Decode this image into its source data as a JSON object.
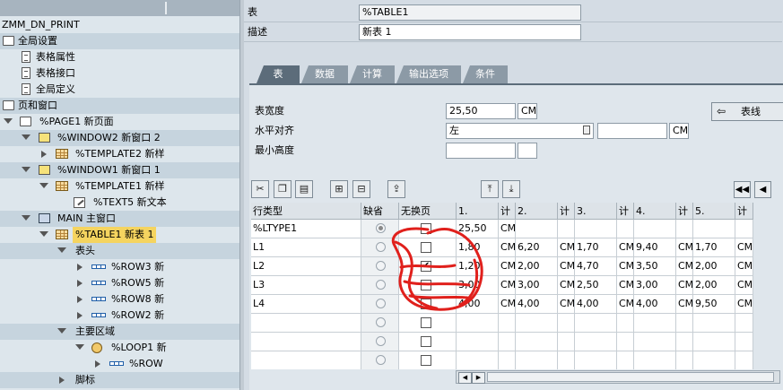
{
  "tree": {
    "rows": [
      {
        "label": "ZMM_DN_PRINT"
      },
      {
        "label": "全局设置"
      },
      {
        "label": "表格属性"
      },
      {
        "label": "表格接口"
      },
      {
        "label": "全局定义"
      },
      {
        "label": "页和窗口"
      },
      {
        "label": "%PAGE1 新页面"
      },
      {
        "label": "%WINDOW2 新窗口 2"
      },
      {
        "label": "%TEMPLATE2 新样"
      },
      {
        "label": "%WINDOW1 新窗口 1"
      },
      {
        "label": "%TEMPLATE1 新样"
      },
      {
        "label": "%TEXT5 新文本"
      },
      {
        "label": "MAIN 主窗口"
      },
      {
        "label": "%TABLE1 新表 1"
      },
      {
        "label": "表头"
      },
      {
        "label": "%ROW3 新"
      },
      {
        "label": "%ROW5 新"
      },
      {
        "label": "%ROW8 新"
      },
      {
        "label": "%ROW2 新"
      },
      {
        "label": "主要区域"
      },
      {
        "label": "%LOOP1 新"
      },
      {
        "label": "%ROW"
      },
      {
        "label": "脚标"
      }
    ]
  },
  "header": {
    "table_label": "表",
    "table_value": "%TABLE1",
    "desc_label": "描述",
    "desc_value": "新表 1"
  },
  "tabs": [
    {
      "label": "表"
    },
    {
      "label": "数据"
    },
    {
      "label": "计算"
    },
    {
      "label": "输出选项"
    },
    {
      "label": "条件"
    }
  ],
  "form": {
    "width_label": "表宽度",
    "width_value": "25,50",
    "width_unit": "CM",
    "align_label": "水平对齐",
    "align_value": "左",
    "align_unit": "CM",
    "minheight_label": "最小高度",
    "side_button": "表线"
  },
  "table": {
    "columns": [
      "行类型",
      "缺省",
      "无换页",
      "1.",
      "计",
      "2.",
      "计",
      "3.",
      "计",
      "4.",
      "计",
      "5.",
      "计"
    ],
    "rows": [
      {
        "type": "%LTYPE1",
        "default": true,
        "nobreak": false,
        "cells": [
          "25,50",
          "CM",
          "",
          "",
          "",
          "",
          "",
          "",
          "",
          ""
        ]
      },
      {
        "type": "L1",
        "default": false,
        "nobreak": false,
        "cells": [
          "1,80",
          "CM",
          "6,20",
          "CM",
          "1,70",
          "CM",
          "9,40",
          "CM",
          "1,70",
          "CM"
        ]
      },
      {
        "type": "L2",
        "default": false,
        "nobreak": true,
        "cells": [
          "1,20",
          "CM",
          "2,00",
          "CM",
          "4,70",
          "CM",
          "3,50",
          "CM",
          "2,00",
          "CM"
        ]
      },
      {
        "type": "L3",
        "default": false,
        "nobreak": false,
        "cells": [
          "3,00",
          "CM",
          "3,00",
          "CM",
          "2,50",
          "CM",
          "3,00",
          "CM",
          "2,00",
          "CM"
        ]
      },
      {
        "type": "L4",
        "default": false,
        "nobreak": false,
        "cells": [
          "4,00",
          "CM",
          "4,00",
          "CM",
          "4,00",
          "CM",
          "4,00",
          "CM",
          "9,50",
          "CM"
        ]
      },
      {
        "type": "",
        "default": false,
        "nobreak": false,
        "cells": [
          "",
          "",
          "",
          "",
          "",
          "",
          "",
          "",
          "",
          ""
        ]
      },
      {
        "type": "",
        "default": false,
        "nobreak": false,
        "cells": [
          "",
          "",
          "",
          "",
          "",
          "",
          "",
          "",
          "",
          ""
        ]
      },
      {
        "type": "",
        "default": false,
        "nobreak": false,
        "cells": [
          "",
          "",
          "",
          "",
          "",
          "",
          "",
          "",
          "",
          ""
        ]
      }
    ]
  },
  "colors": {
    "selected": "#f5d45f",
    "active_tab": "#5c6c7a",
    "annotation": "#e0201c"
  }
}
